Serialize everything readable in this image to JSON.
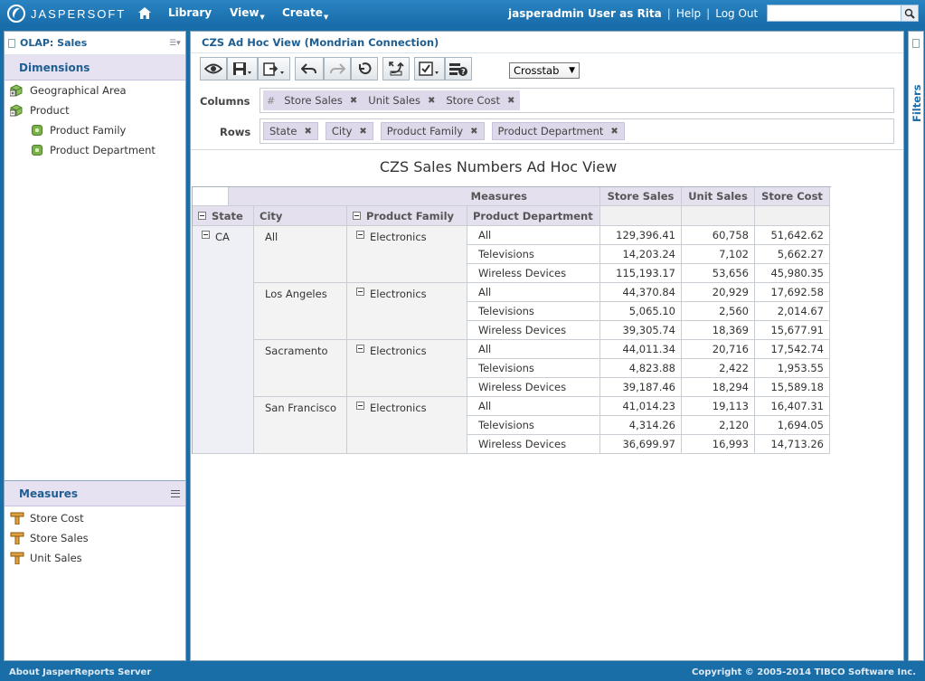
{
  "brand": {
    "name": "JASPERSOFT"
  },
  "nav": {
    "library": "Library",
    "view": "View",
    "create": "Create"
  },
  "user": {
    "info": "jasperadmin User as Rita",
    "help": "Help",
    "logout": "Log Out",
    "search_placeholder": ""
  },
  "left": {
    "title": "OLAP: Sales",
    "dimensions_title": "Dimensions",
    "dimensions": [
      {
        "label": "Geographical Area",
        "icon": "cube-collapsed-icon"
      },
      {
        "label": "Product",
        "icon": "cube-expanded-icon"
      },
      {
        "label": "Product Family",
        "icon": "level-icon"
      },
      {
        "label": "Product Department",
        "icon": "level-icon"
      }
    ],
    "measures_title": "Measures",
    "measures": [
      "Store Cost",
      "Store Sales",
      "Unit Sales"
    ]
  },
  "main": {
    "title": "CZS Ad Hoc View (Mondrian Connection)",
    "view_type": "Crosstab",
    "columns_label": "Columns",
    "rows_label": "Rows",
    "columns_hash": "#",
    "column_pills": [
      "Store Sales",
      "Unit Sales",
      "Store Cost"
    ],
    "row_pills": [
      "State",
      "City",
      "Product Family",
      "Product Department"
    ],
    "report_title": "CZS Sales Numbers Ad Hoc View"
  },
  "crosstab": {
    "measures_header": "Measures",
    "measure_cols": [
      "Store Sales",
      "Unit Sales",
      "Store Cost"
    ],
    "row_headers": [
      "State",
      "City",
      "Product Family",
      "Product Department"
    ],
    "state": "CA",
    "groups": [
      {
        "city": "All",
        "family": "Electronics",
        "rows": [
          {
            "dept": "All",
            "v": [
              "129,396.41",
              "60,758",
              "51,642.62"
            ]
          },
          {
            "dept": "Televisions",
            "v": [
              "14,203.24",
              "7,102",
              "5,662.27"
            ]
          },
          {
            "dept": "Wireless Devices",
            "v": [
              "115,193.17",
              "53,656",
              "45,980.35"
            ]
          }
        ]
      },
      {
        "city": "Los Angeles",
        "family": "Electronics",
        "rows": [
          {
            "dept": "All",
            "v": [
              "44,370.84",
              "20,929",
              "17,692.58"
            ]
          },
          {
            "dept": "Televisions",
            "v": [
              "5,065.10",
              "2,560",
              "2,014.67"
            ]
          },
          {
            "dept": "Wireless Devices",
            "v": [
              "39,305.74",
              "18,369",
              "15,677.91"
            ]
          }
        ]
      },
      {
        "city": "Sacramento",
        "family": "Electronics",
        "rows": [
          {
            "dept": "All",
            "v": [
              "44,011.34",
              "20,716",
              "17,542.74"
            ]
          },
          {
            "dept": "Televisions",
            "v": [
              "4,823.88",
              "2,422",
              "1,953.55"
            ]
          },
          {
            "dept": "Wireless Devices",
            "v": [
              "39,187.46",
              "18,294",
              "15,589.18"
            ]
          }
        ]
      },
      {
        "city": "San Francisco",
        "family": "Electronics",
        "rows": [
          {
            "dept": "All",
            "v": [
              "41,014.23",
              "19,113",
              "16,407.31"
            ]
          },
          {
            "dept": "Televisions",
            "v": [
              "4,314.26",
              "2,120",
              "1,694.05"
            ]
          },
          {
            "dept": "Wireless Devices",
            "v": [
              "36,699.97",
              "16,993",
              "14,713.26"
            ]
          }
        ]
      }
    ]
  },
  "filters": {
    "label": "Filters"
  },
  "footer": {
    "about": "About JasperReports Server",
    "copyright": "Copyright © 2005-2014 TIBCO Software Inc."
  }
}
